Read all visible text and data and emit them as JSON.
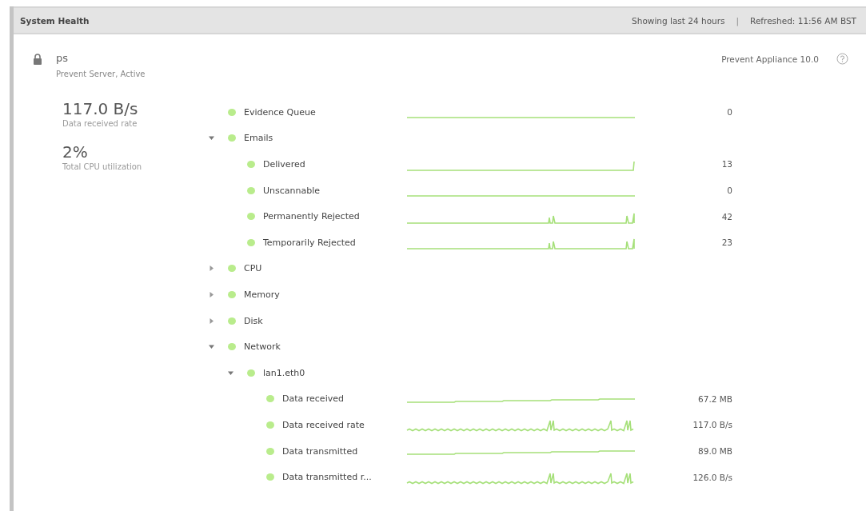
{
  "header": {
    "title": "System Health",
    "range": "Showing last 24 hours",
    "separator": "|",
    "refreshed": "Refreshed: 11:56 AM BST"
  },
  "server": {
    "name": "ps",
    "subtitle": "Prevent Server, Active",
    "version": "Prevent Appliance 10.0"
  },
  "summary": [
    {
      "value": "117.0 B/s",
      "label": "Data received rate"
    },
    {
      "value": "2%",
      "label": "Total CPU utilization"
    }
  ],
  "tree": [
    {
      "label": "Evidence Queue",
      "color": "#b9ec8c",
      "kind": "flat",
      "value": "0"
    },
    {
      "label": "Emails",
      "color": "#b9ec8c",
      "expanded": true,
      "children": [
        {
          "label": "Delivered",
          "color": "#b9ec8c",
          "kind": "step",
          "value": "13"
        },
        {
          "label": "Unscannable",
          "color": "#b9ec8c",
          "kind": "flat",
          "value": "0"
        },
        {
          "label": "Permanently Rejected",
          "color": "#b9ec8c",
          "kind": "spikes",
          "value": "42"
        },
        {
          "label": "Temporarily Rejected",
          "color": "#b9ec8c",
          "kind": "spikes",
          "value": "23"
        }
      ]
    },
    {
      "label": "CPU",
      "color": "#b9ec8c",
      "expanded": false
    },
    {
      "label": "Memory",
      "color": "#b9ec8c",
      "expanded": false
    },
    {
      "label": "Disk",
      "color": "#b9ec8c",
      "expanded": false
    },
    {
      "label": "Network",
      "color": "#b9ec8c",
      "expanded": true,
      "children": [
        {
          "label": "lan1.eth0",
          "color": "#b9ec8c",
          "expanded": true,
          "children": [
            {
              "label": "Data received",
              "color": "#b9ec8c",
              "kind": "rising",
              "value": "67.2 MB"
            },
            {
              "label": "Data received rate",
              "color": "#b9ec8c",
              "kind": "noisy",
              "value": "117.0 B/s"
            },
            {
              "label": "Data transmitted",
              "color": "#b9ec8c",
              "kind": "rising",
              "value": "89.0 MB"
            },
            {
              "label": "Data transmitted r...",
              "color": "#b9ec8c",
              "kind": "noisy",
              "value": "126.0 B/s"
            }
          ]
        }
      ]
    }
  ]
}
